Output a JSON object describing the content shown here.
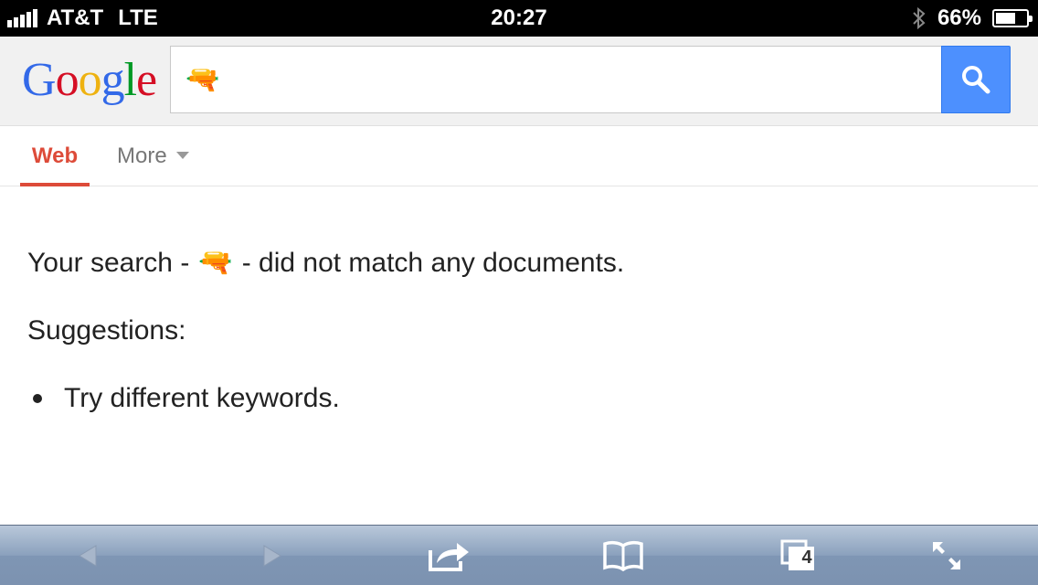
{
  "status_bar": {
    "carrier": "AT&T",
    "network": "LTE",
    "time": "20:27",
    "battery_percent": "66%",
    "battery_level": 0.66
  },
  "search": {
    "logo": [
      "G",
      "o",
      "o",
      "g",
      "l",
      "e"
    ],
    "logo_colors": [
      "#3369e8",
      "#d50f25",
      "#eeb211",
      "#3369e8",
      "#009925",
      "#d50f25"
    ],
    "query": "🔫"
  },
  "tabs": {
    "web_label": "Web",
    "more_label": "More"
  },
  "results": {
    "no_match_prefix": "Your search -",
    "query_emoji": "🔫",
    "no_match_suffix": "- did not match any documents.",
    "suggestions_heading": "Suggestions:",
    "suggestion_1": "Try different keywords."
  },
  "toolbar": {
    "tab_count": "4"
  },
  "colors": {
    "accent_red": "#dd4b39",
    "search_button": "#4d90fe"
  }
}
